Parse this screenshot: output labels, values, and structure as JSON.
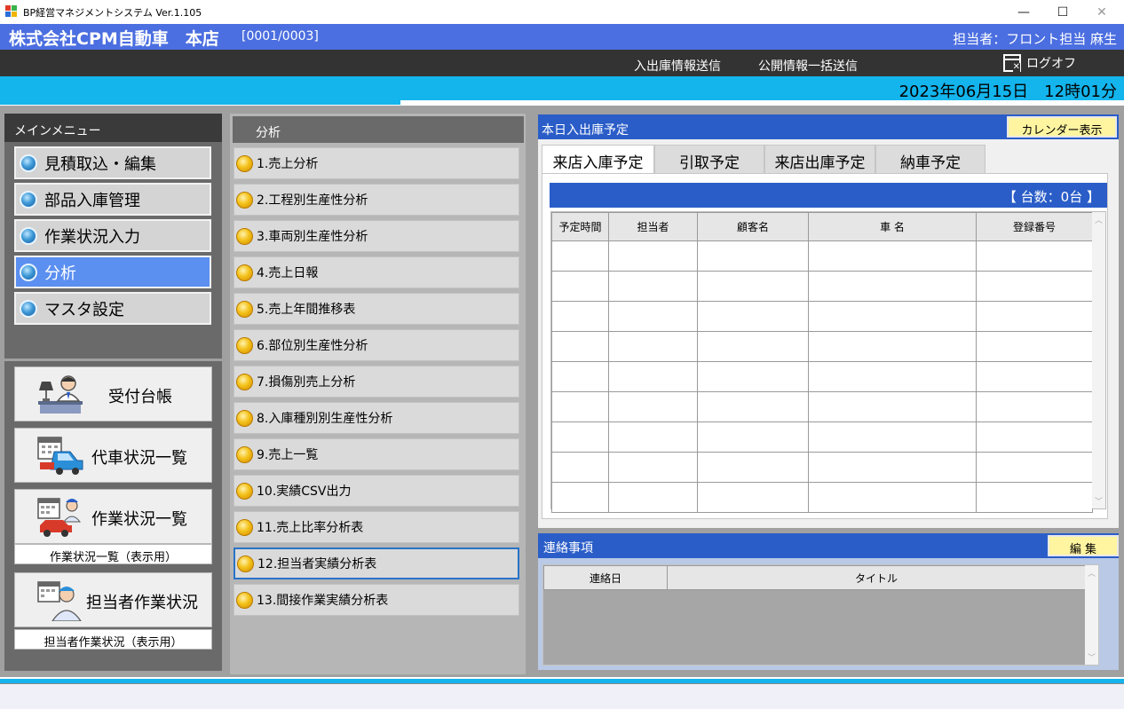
{
  "window": {
    "title": "BP経営マネジメントシステム Ver.1.105",
    "minimize": "—",
    "maximize": "☐",
    "close": "✕"
  },
  "header": {
    "company": "株式会社CPM自動車　本店",
    "code": "[0001/0003]",
    "staff": "担当者：フロント担当 麻生"
  },
  "nav": {
    "send_inout": "入出庫情報送信",
    "send_public": "公開情報一括送信",
    "logoff": "ログオフ"
  },
  "datetime": "2023年06月15日　12時01分",
  "progress": {
    "fraction": 0.356
  },
  "main_menu": {
    "title": "メインメニュー",
    "items": [
      {
        "label": "見積取込・編集",
        "active": false
      },
      {
        "label": "部品入庫管理",
        "active": false
      },
      {
        "label": "作業状況入力",
        "active": false
      },
      {
        "label": "分析",
        "active": true
      },
      {
        "label": "マスタ設定",
        "active": false
      }
    ]
  },
  "quick": {
    "reception": "受付台帳",
    "loaner": "代車状況一覧",
    "work_status": "作業状況一覧",
    "work_status_display": "作業状況一覧（表示用）",
    "staff_work": "担当者作業状況",
    "staff_work_display": "担当者作業状況（表示用）"
  },
  "analysis": {
    "title": "分析",
    "selected_index": 11,
    "items": [
      "1.売上分析",
      "2.工程別生産性分析",
      "3.車両別生産性分析",
      "4.売上日報",
      "5.売上年間推移表",
      "6.部位別生産性分析",
      "7.損傷別売上分析",
      "8.入庫種別別生産性分析",
      "9.売上一覧",
      "10.実績CSV出力",
      "11.売上比率分析表",
      "12.担当者実績分析表",
      "13.間接作業実績分析表"
    ]
  },
  "schedule": {
    "title": "本日入出庫予定",
    "calendar_button": "カレンダー表示",
    "tabs": [
      "来店入庫予定",
      "引取予定",
      "来店出庫予定",
      "納車予定"
    ],
    "active_tab": 0,
    "count": "【 台数：0台 】",
    "columns": [
      "予定時間",
      "担当者",
      "顧客名",
      "車 名",
      "登録番号"
    ],
    "row_count": 9
  },
  "notice": {
    "title": "連絡事項",
    "edit_button": "編 集",
    "columns": [
      "連絡日",
      "タイトル"
    ]
  },
  "colors": {
    "brand_blue": "#4b6ee0",
    "header_blue": "#2a5dc8",
    "accent_cyan": "#14b4ec",
    "active_menu": "#5b8ff0",
    "button_yellow": "#fff5a0"
  },
  "icons": {
    "menu_item": "globe-icon",
    "analysis_item": "coin-icon",
    "logoff": "logoff-icon",
    "reception": "reception-desk-icon",
    "loaner": "loaner-car-icon",
    "work_status": "work-status-icon",
    "staff_work": "staff-icon"
  }
}
